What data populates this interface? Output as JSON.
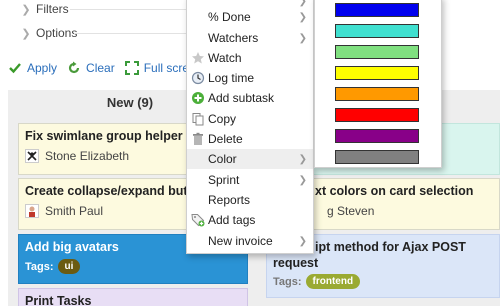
{
  "filters": {
    "filters_label": "Filters",
    "options_label": "Options"
  },
  "actions": {
    "apply": "Apply",
    "clear": "Clear",
    "fullscreen": "Full screen"
  },
  "column": {
    "title": "New (9)"
  },
  "cards": [
    {
      "title": "Fix swimlane group helper",
      "person": "Stone Elizabeth"
    },
    {
      "title": "Create collapse/expand butto",
      "person": "Smith Paul"
    },
    {
      "title": "Add big avatars",
      "tags_label": "Tags:",
      "tag": "ui"
    },
    {
      "title": "Print Tasks"
    },
    {
      "title": "xt colors on card selection",
      "person": "g Steven"
    },
    {
      "title": "ipt method for Ajax POST",
      "title2": "request",
      "tags_label": "Tags:",
      "tag": "frontend"
    }
  ],
  "menu": {
    "items": [
      {
        "label": "% Done",
        "icon": "none",
        "submenu": true
      },
      {
        "label": "Watchers",
        "icon": "none",
        "submenu": true
      },
      {
        "label": "Watch",
        "icon": "star-icon",
        "submenu": false
      },
      {
        "label": "Log time",
        "icon": "clock-icon",
        "submenu": false
      },
      {
        "label": "Add subtask",
        "icon": "add-icon",
        "submenu": false
      },
      {
        "label": "Copy",
        "icon": "copy-icon",
        "submenu": false
      },
      {
        "label": "Delete",
        "icon": "trash-icon",
        "submenu": false
      },
      {
        "label": "Color",
        "icon": "none",
        "submenu": true
      },
      {
        "label": "Sprint",
        "icon": "none",
        "submenu": true
      },
      {
        "label": "Reports",
        "icon": "none",
        "submenu": false
      },
      {
        "label": "Add tags",
        "icon": "tag-add-icon",
        "submenu": false
      },
      {
        "label": "New invoice",
        "icon": "none",
        "submenu": true
      }
    ]
  },
  "palette": {
    "colors": [
      "#0000ee",
      "#40e0d0",
      "#80e080",
      "#ffff00",
      "#ff9900",
      "#ff0000",
      "#880088",
      "#808080"
    ]
  }
}
